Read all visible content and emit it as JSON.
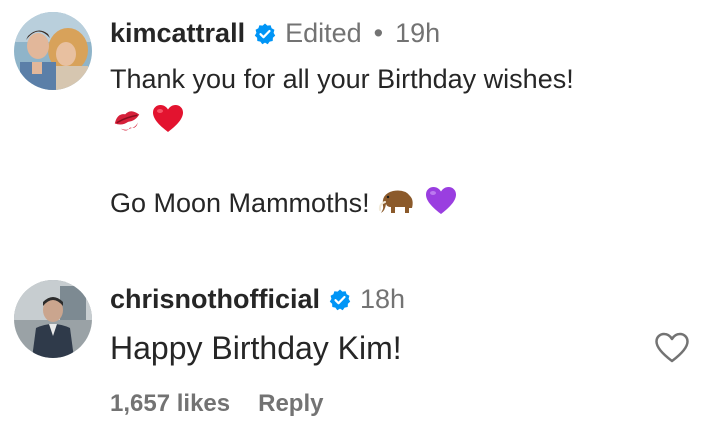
{
  "comments": [
    {
      "username": "kimcattrall",
      "edited_label": "Edited",
      "separator": "•",
      "time": "19h",
      "lines": [
        "Thank you for all your Birthday wishes!",
        "Go Moon Mammoths!"
      ],
      "emojis": [
        "kiss-mark-icon",
        "red-heart-icon",
        "mammoth-icon",
        "purple-heart-icon"
      ]
    },
    {
      "username": "chrisnothofficial",
      "time": "18h",
      "lines": [
        "Happy Birthday Kim!"
      ],
      "likes_label": "1,657 likes",
      "reply_label": "Reply"
    }
  ],
  "colors": {
    "text": "#262626",
    "secondary": "#737373",
    "verified": "#0095F6"
  }
}
